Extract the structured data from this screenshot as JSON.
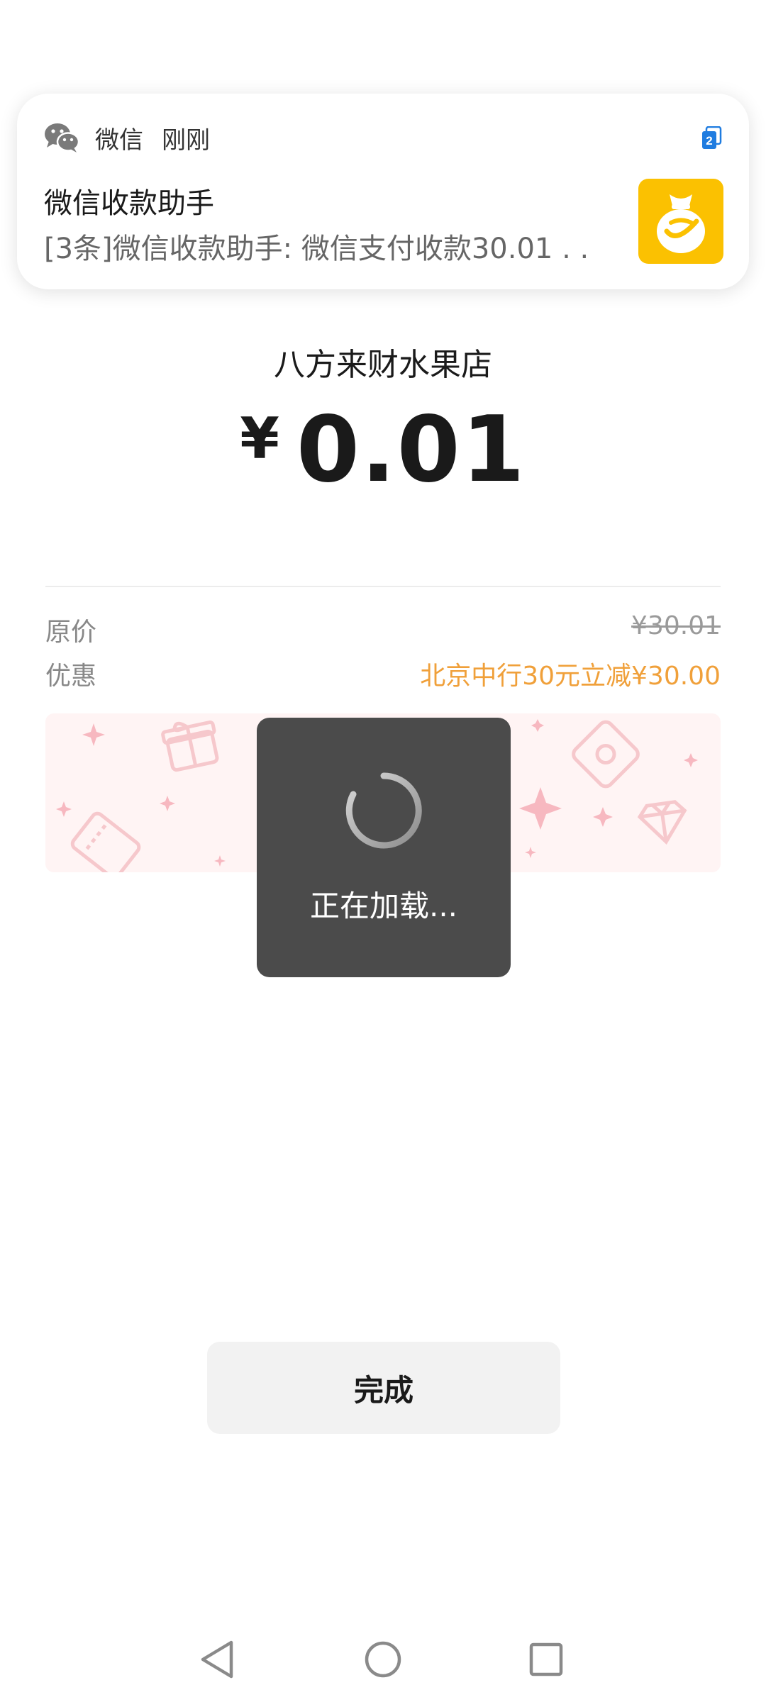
{
  "notification": {
    "app_name": "微信",
    "time": "刚刚",
    "title": "微信收款助手",
    "text": "[3条]微信收款助手: 微信支付收款30.01 . .",
    "badge_count": "2",
    "icons": {
      "app": "wechat-icon",
      "grouped": "copy-icon",
      "thumbnail": "money-bag-icon"
    },
    "thumbnail_color": "#fbc101"
  },
  "payment": {
    "merchant": "八方来财水果店",
    "currency_symbol": "¥",
    "amount": "0.01",
    "original_price_label": "原价",
    "original_price_value": "¥30.01",
    "discount_label": "优惠",
    "discount_value": "北京中行30元立减¥30.00",
    "discount_color": "#f0a03a",
    "banner_color": "#fff4f4"
  },
  "loading": {
    "text": "正在加载..."
  },
  "actions": {
    "done_label": "完成"
  },
  "navigation": {
    "icons": [
      "back-icon",
      "home-icon",
      "recent-apps-icon"
    ]
  }
}
